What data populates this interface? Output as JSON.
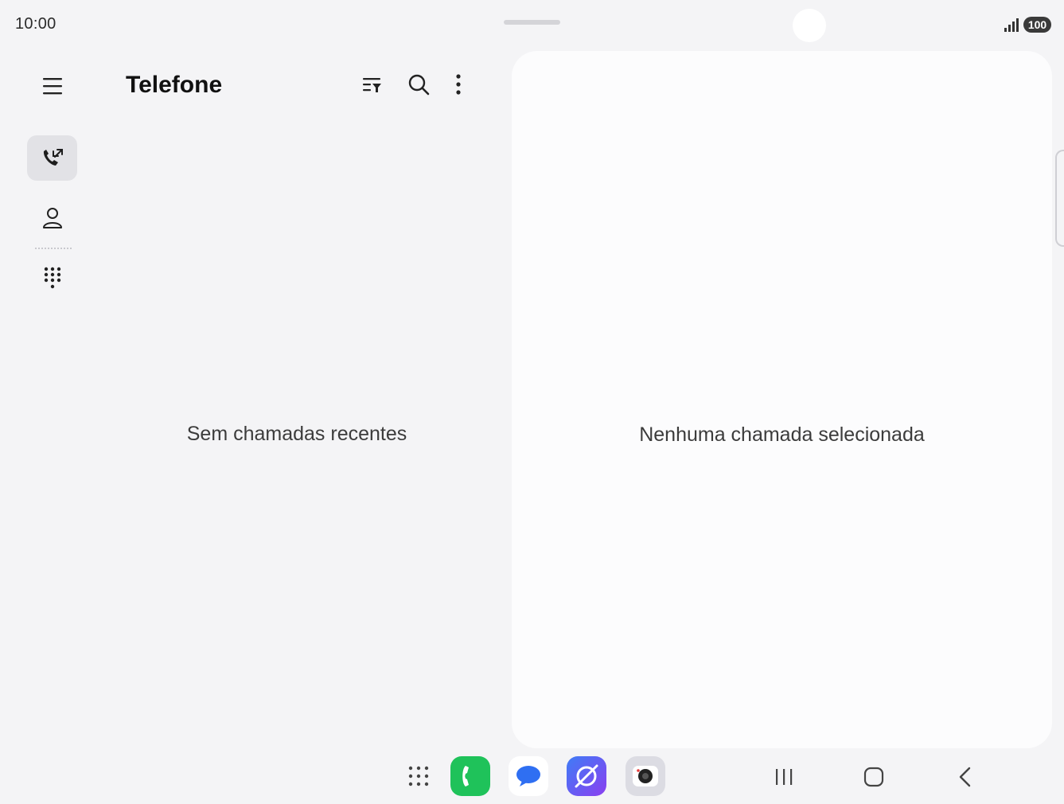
{
  "status_bar": {
    "time": "10:00",
    "battery": "100",
    "icons": [
      "signal-icon",
      "battery-icon"
    ]
  },
  "header": {
    "title": "Telefone",
    "icons": [
      "menu-icon",
      "filter-icon",
      "search-icon",
      "more-options-icon"
    ]
  },
  "nav_rail": {
    "items": [
      {
        "name": "recents",
        "icon": "recent-calls-icon",
        "active": true
      },
      {
        "name": "contacts",
        "icon": "contacts-icon",
        "active": false
      },
      {
        "name": "keypad",
        "icon": "keypad-icon",
        "active": false
      }
    ]
  },
  "list_pane": {
    "empty_message": "Sem chamadas recentes"
  },
  "detail_pane": {
    "empty_message": "Nenhuma chamada selecionada"
  },
  "taskbar": {
    "apps": [
      {
        "name": "apps-grid",
        "icon": "apps-grid-icon"
      },
      {
        "name": "phone",
        "icon": "phone-icon",
        "color": "#1fc25a"
      },
      {
        "name": "messages",
        "icon": "messages-icon",
        "color": "#2f6ff2"
      },
      {
        "name": "internet",
        "icon": "internet-icon",
        "color": "#5b4ff0"
      },
      {
        "name": "camera",
        "icon": "camera-icon",
        "color": "#dcdce3"
      }
    ],
    "nav": [
      "recent-apps-icon",
      "home-icon",
      "back-icon"
    ]
  },
  "colors": {
    "background": "#f4f4f6",
    "pane": "#fcfcfd",
    "active_rail": "#e2e2e6"
  }
}
